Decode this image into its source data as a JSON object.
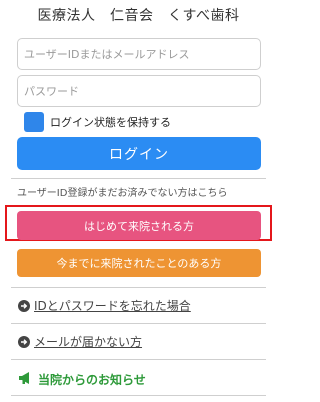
{
  "header": {
    "title": "医療法人　仁音会　くすべ歯科"
  },
  "login_form": {
    "userid_placeholder": "ユーザーIDまたはメールアドレス",
    "password_placeholder": "パスワード",
    "remember_label": "ログイン状態を保持する",
    "login_button": "ログイン"
  },
  "registration": {
    "notice": "ユーザーID登録がまだお済みでない方はこちら",
    "first_visit_button": "はじめて来院される方",
    "returning_button": "今までに来院されたことのある方"
  },
  "links": {
    "forgot": "IDとパスワードを忘れた場合",
    "mail_not_received": "メールが届かない方"
  },
  "news": {
    "label": "当院からのお知らせ"
  },
  "colors": {
    "login_blue": "#2b8cf3",
    "first_visit_pink": "#e75480",
    "returning_orange": "#ee9433",
    "highlight_red": "#e4171b",
    "news_green": "#2e9a3a"
  }
}
